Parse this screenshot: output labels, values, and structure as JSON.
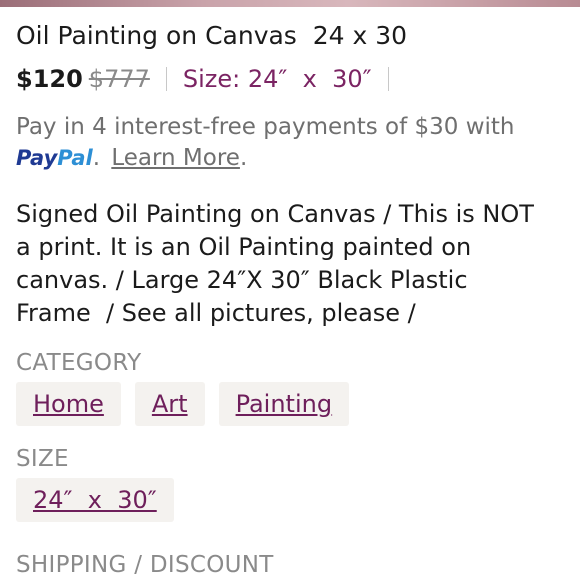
{
  "listing": {
    "title": "Oil Painting on Canvas  24 x 30",
    "price": "$120",
    "original_price": "$777",
    "size_inline": "Size: 24″  x  30″"
  },
  "paypal": {
    "text": "Pay in 4 interest-free payments of $30 with",
    "logo_pay": "Pay",
    "logo_pal": "Pal",
    "period": ".",
    "learn_more": "Learn More",
    "end_period": "."
  },
  "description": "Signed Oil Painting on Canvas / This is NOT\na print. It is an Oil Painting painted on\ncanvas. / Large 24″X 30″ Black Plastic\nFrame  / See all pictures, please /",
  "category": {
    "label": "CATEGORY",
    "items": [
      "Home",
      "Art",
      "Painting"
    ]
  },
  "size": {
    "label": "SIZE",
    "value": "24″  x  30″"
  },
  "shipping": {
    "label": "SHIPPING / DISCOUNT"
  },
  "colors": {
    "accent": "#7b2463",
    "link": "#6e1f5b",
    "chip_bg": "#f4f2ef",
    "muted": "#8a8a8a"
  }
}
